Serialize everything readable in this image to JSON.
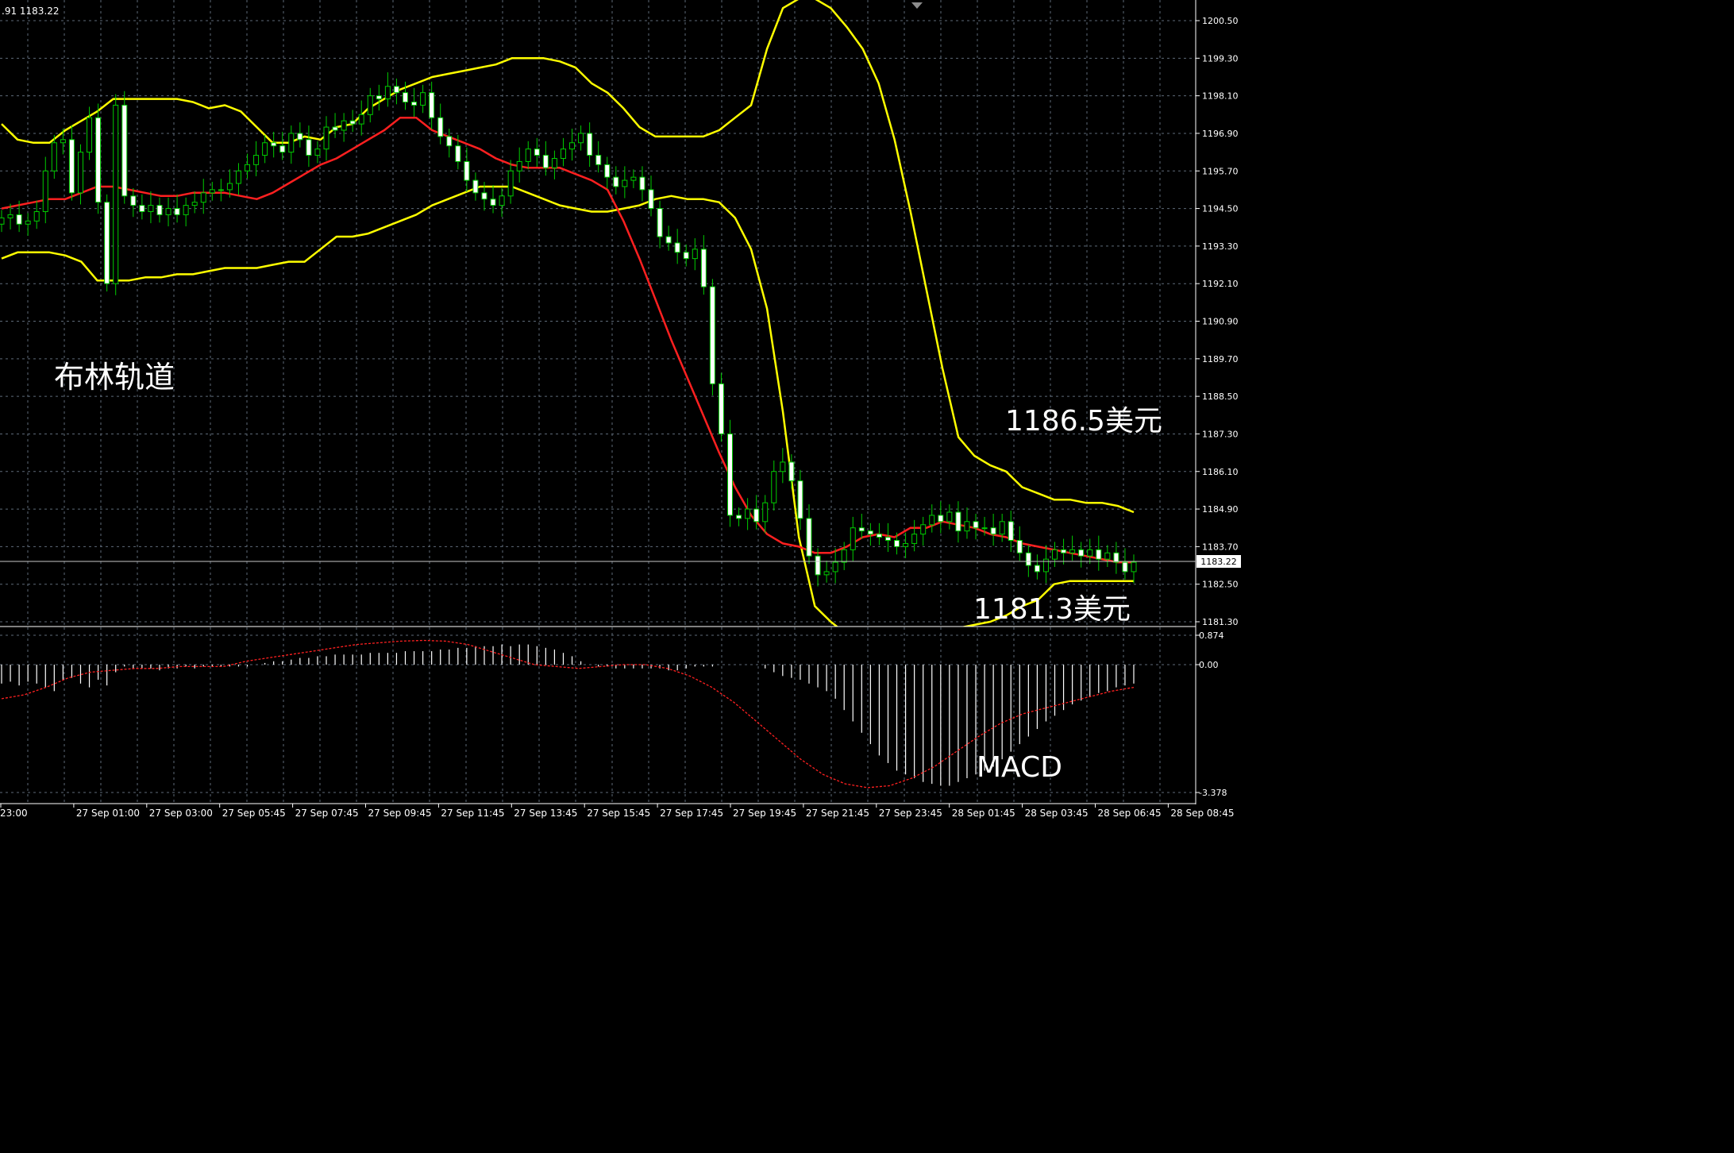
{
  "header": {
    "ohlc_text": ".91 1183.22"
  },
  "annotations": {
    "bollinger_label": "布林轨道",
    "upper_price": "1186.5美元",
    "lower_price": "1181.3美元",
    "macd_label": "MACD"
  },
  "colors": {
    "background": "#000000",
    "grid": "#5e6a78",
    "bullish": "#00cc00",
    "bearish_body": "#ffffff",
    "bollinger": "#ffff00",
    "middle_band": "#ff2020",
    "macd_hist": "#ffffff",
    "macd_signal": "#ff2020",
    "text": "#ffffff",
    "axis": "#ffffff"
  },
  "chart_data": [
    {
      "type": "candlestick",
      "title": "",
      "current_price": 1183.22,
      "current_price_label": "1183.22",
      "ylim": [
        1181.0,
        1201.2
      ],
      "y_ticks": [
        "1200.50",
        "1199.30",
        "1198.10",
        "1196.90",
        "1195.70",
        "1194.50",
        "1193.30",
        "1192.10",
        "1190.90",
        "1189.70",
        "1188.50",
        "1187.30",
        "1186.10",
        "1184.90",
        "1183.70",
        "1182.50",
        "1181.30"
      ],
      "x_ticks": [
        "23:00",
        "27 Sep 01:00",
        "27 Sep 03:00",
        "27 Sep 05:45",
        "27 Sep 07:45",
        "27 Sep 09:45",
        "27 Sep 11:45",
        "27 Sep 13:45",
        "27 Sep 15:45",
        "27 Sep 17:45",
        "27 Sep 19:45",
        "27 Sep 21:45",
        "27 Sep 23:45",
        "28 Sep 01:45",
        "28 Sep 03:45",
        "28 Sep 06:45",
        "28 Sep 08:45"
      ],
      "close": [
        1194.2,
        1194.3,
        1194.0,
        1194.1,
        1194.4,
        1195.7,
        1196.6,
        1196.7,
        1195.0,
        1196.3,
        1197.4,
        1194.7,
        1192.1,
        1197.8,
        1194.9,
        1194.6,
        1194.4,
        1194.6,
        1194.3,
        1194.5,
        1194.3,
        1194.6,
        1194.7,
        1195.0,
        1195.1,
        1195.1,
        1195.3,
        1195.7,
        1195.9,
        1196.2,
        1196.6,
        1196.5,
        1196.3,
        1196.9,
        1196.7,
        1196.2,
        1196.4,
        1197.1,
        1197.0,
        1197.3,
        1197.2,
        1197.5,
        1198.1,
        1198.0,
        1198.4,
        1198.2,
        1197.9,
        1197.8,
        1198.2,
        1197.4,
        1196.8,
        1196.5,
        1196.0,
        1195.4,
        1195.0,
        1194.8,
        1194.6,
        1194.9,
        1195.7,
        1196.0,
        1196.4,
        1196.2,
        1195.8,
        1196.1,
        1196.4,
        1196.6,
        1196.9,
        1196.2,
        1195.9,
        1195.5,
        1195.2,
        1195.4,
        1195.5,
        1195.1,
        1194.5,
        1193.6,
        1193.4,
        1193.1,
        1192.9,
        1193.2,
        1192.0,
        1188.9,
        1187.3,
        1184.7,
        1184.6,
        1184.9,
        1184.5,
        1185.1,
        1186.1,
        1186.4,
        1185.8,
        1184.6,
        1183.4,
        1182.8,
        1182.9,
        1183.2,
        1183.6,
        1184.3,
        1184.2,
        1184.1,
        1184.0,
        1183.9,
        1183.7,
        1183.8,
        1184.1,
        1184.4,
        1184.7,
        1184.5,
        1184.8,
        1184.2,
        1184.5,
        1184.3,
        1184.3,
        1184.1,
        1184.5,
        1183.9,
        1183.5,
        1183.1,
        1182.9,
        1183.3,
        1183.6,
        1183.5,
        1183.6,
        1183.4,
        1183.6,
        1183.3,
        1183.5,
        1183.2,
        1182.9,
        1183.2
      ],
      "bollinger_upper": [
        1197.2,
        1196.7,
        1196.6,
        1196.6,
        1197.0,
        1197.3,
        1197.6,
        1198.0,
        1198.0,
        1198.0,
        1198.0,
        1198.0,
        1197.9,
        1197.7,
        1197.8,
        1197.6,
        1197.1,
        1196.6,
        1196.6,
        1196.8,
        1196.7,
        1197.1,
        1197.2,
        1197.7,
        1198.0,
        1198.3,
        1198.5,
        1198.7,
        1198.8,
        1198.9,
        1199.0,
        1199.1,
        1199.3,
        1199.3,
        1199.3,
        1199.2,
        1199.0,
        1198.5,
        1198.2,
        1197.7,
        1197.1,
        1196.8,
        1196.8,
        1196.8,
        1196.8,
        1197.0,
        1197.4,
        1197.8,
        1199.6,
        1200.9,
        1201.2,
        1201.2,
        1200.9,
        1200.3,
        1199.6,
        1198.5,
        1196.7,
        1194.4,
        1191.9,
        1189.4,
        1187.2,
        1186.6,
        1186.3,
        1186.1,
        1185.6,
        1185.4,
        1185.2,
        1185.2,
        1185.1,
        1185.1,
        1185.0,
        1184.8
      ],
      "bollinger_middle": [
        1194.5,
        1194.6,
        1194.7,
        1194.8,
        1194.8,
        1195.0,
        1195.2,
        1195.2,
        1195.1,
        1195.0,
        1194.9,
        1194.9,
        1195.0,
        1195.0,
        1195.0,
        1194.9,
        1194.8,
        1195.0,
        1195.3,
        1195.6,
        1195.9,
        1196.1,
        1196.4,
        1196.7,
        1197.0,
        1197.4,
        1197.4,
        1197.0,
        1196.8,
        1196.6,
        1196.4,
        1196.1,
        1195.9,
        1195.8,
        1195.8,
        1195.8,
        1195.6,
        1195.4,
        1195.1,
        1194.1,
        1192.9,
        1191.6,
        1190.3,
        1189.1,
        1187.9,
        1186.7,
        1185.6,
        1184.7,
        1184.1,
        1183.8,
        1183.7,
        1183.5,
        1183.5,
        1183.7,
        1184.0,
        1184.1,
        1184.0,
        1184.3,
        1184.3,
        1184.5,
        1184.4,
        1184.3,
        1184.1,
        1184.0,
        1183.8,
        1183.7,
        1183.6,
        1183.5,
        1183.4,
        1183.3,
        1183.2,
        1183.2
      ],
      "bollinger_lower": [
        1192.9,
        1193.1,
        1193.1,
        1193.1,
        1193.0,
        1192.8,
        1192.2,
        1192.2,
        1192.2,
        1192.3,
        1192.3,
        1192.4,
        1192.4,
        1192.5,
        1192.6,
        1192.6,
        1192.6,
        1192.7,
        1192.8,
        1192.8,
        1193.2,
        1193.6,
        1193.6,
        1193.7,
        1193.9,
        1194.1,
        1194.3,
        1194.6,
        1194.8,
        1195.0,
        1195.2,
        1195.2,
        1195.2,
        1195.0,
        1194.8,
        1194.6,
        1194.5,
        1194.4,
        1194.4,
        1194.5,
        1194.6,
        1194.8,
        1194.9,
        1194.8,
        1194.8,
        1194.7,
        1194.2,
        1193.2,
        1191.3,
        1188.0,
        1184.0,
        1181.8,
        1181.3,
        1180.9,
        1180.5,
        1180.6,
        1180.8,
        1180.9,
        1181.0,
        1181.0,
        1181.1,
        1181.2,
        1181.3,
        1181.5,
        1181.8,
        1182.0,
        1182.5,
        1182.6,
        1182.6,
        1182.6,
        1182.6,
        1182.6
      ]
    },
    {
      "type": "macd",
      "title": "MACD",
      "ylim": [
        -3.378,
        0.874
      ],
      "y_ticks": [
        "0.874",
        "0.00",
        "-3.378"
      ],
      "histogram": [
        -0.5,
        -0.45,
        -0.55,
        -0.45,
        -0.5,
        -0.6,
        -0.7,
        -0.4,
        -0.35,
        -0.5,
        -0.6,
        -0.4,
        -0.55,
        -0.2,
        -0.05,
        -0.1,
        -0.1,
        -0.1,
        -0.15,
        -0.1,
        -0.1,
        -0.05,
        -0.1,
        -0.05,
        -0.05,
        -0.05,
        -0.05,
        -0.05,
        -0.05,
        0.0,
        0.05,
        0.1,
        0.1,
        0.15,
        0.2,
        0.2,
        0.25,
        0.25,
        0.3,
        0.3,
        0.3,
        0.3,
        0.35,
        0.35,
        0.35,
        0.35,
        0.4,
        0.4,
        0.4,
        0.4,
        0.45,
        0.45,
        0.5,
        0.5,
        0.55,
        0.55,
        0.55,
        0.6,
        0.55,
        0.6,
        0.6,
        0.55,
        0.5,
        0.45,
        0.35,
        0.25,
        0.1,
        0.0,
        -0.05,
        -0.05,
        -0.1,
        -0.1,
        -0.1,
        -0.1,
        -0.1,
        -0.1,
        -0.15,
        -0.15,
        -0.1,
        -0.05,
        -0.05,
        -0.05,
        0.0,
        0.0,
        0.0,
        0.0,
        0.0,
        -0.1,
        -0.2,
        -0.3,
        -0.35,
        -0.4,
        -0.5,
        -0.6,
        -0.7,
        -0.9,
        -1.2,
        -1.5,
        -1.8,
        -2.1,
        -2.4,
        -2.6,
        -2.8,
        -2.9,
        -3.0,
        -3.1,
        -3.15,
        -3.2,
        -3.2,
        -3.1,
        -3.0,
        -2.9,
        -2.8,
        -2.7,
        -2.5,
        -2.3,
        -2.1,
        -1.9,
        -1.7,
        -1.5,
        -1.35,
        -1.2,
        -1.05,
        -0.95,
        -0.85,
        -0.75,
        -0.7,
        -0.6,
        -0.55,
        -0.5
      ],
      "signal": [
        -0.9,
        -0.8,
        -0.6,
        -0.35,
        -0.2,
        -0.15,
        -0.1,
        -0.1,
        -0.05,
        -0.05,
        -0.05,
        0.1,
        0.2,
        0.3,
        0.4,
        0.5,
        0.6,
        0.65,
        0.7,
        0.72,
        0.7,
        0.6,
        0.4,
        0.2,
        0.0,
        -0.05,
        -0.1,
        -0.05,
        0.0,
        0.0,
        -0.1,
        -0.3,
        -0.6,
        -1.0,
        -1.5,
        -2.0,
        -2.5,
        -2.9,
        -3.15,
        -3.25,
        -3.2,
        -3.0,
        -2.7,
        -2.3,
        -1.9,
        -1.55,
        -1.3,
        -1.15,
        -1.0,
        -0.85,
        -0.7,
        -0.6
      ]
    }
  ]
}
